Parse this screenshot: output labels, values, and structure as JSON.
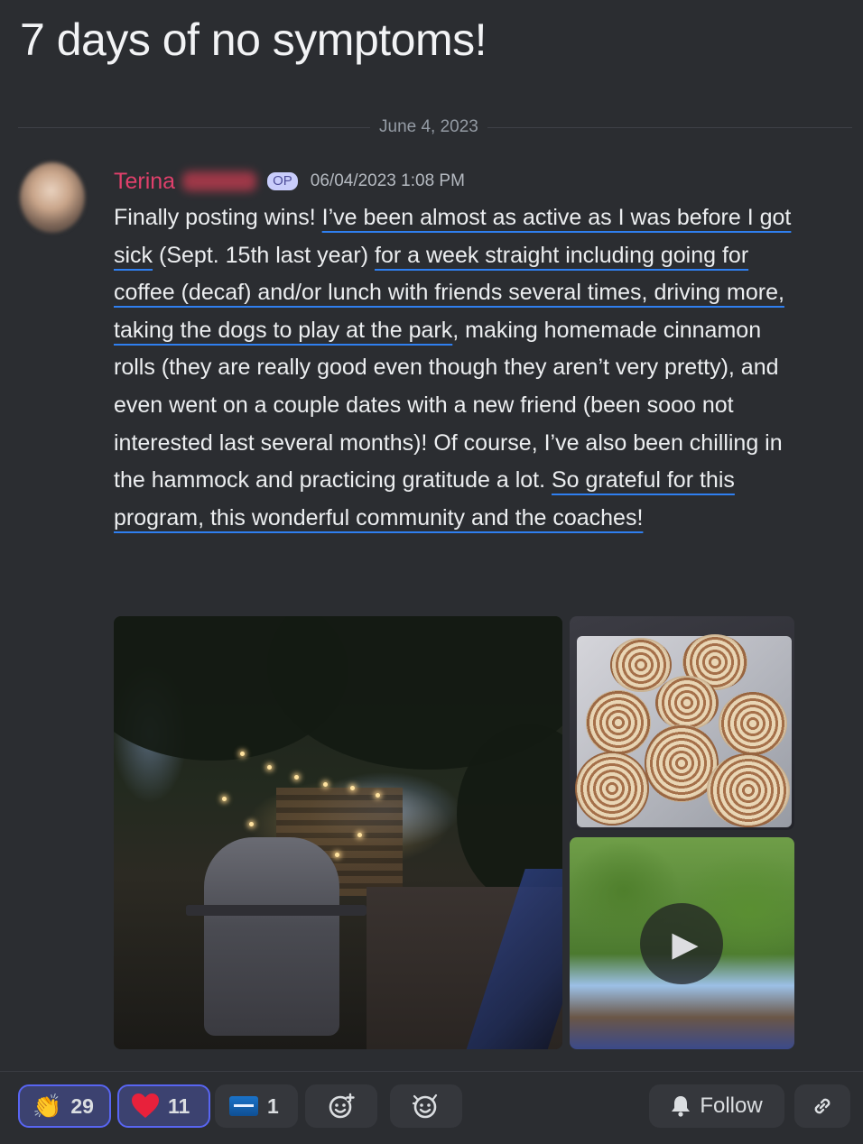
{
  "post": {
    "title": "7 days of no symptoms!",
    "date_divider": "June 4, 2023"
  },
  "message": {
    "author": "Terina",
    "badge": "OP",
    "timestamp": "06/04/2023 1:08 PM",
    "segments": [
      {
        "text": "Finally posting wins! ",
        "highlight": false
      },
      {
        "text": "I’ve been almost as active as I was before I got sick",
        "highlight": true
      },
      {
        "text": " (Sept. 15th last year) ",
        "highlight": false
      },
      {
        "text": "for a week straight including going for coffee (decaf) and/or lunch with friends several times, driving more,  taking the dogs to play at the park",
        "highlight": true
      },
      {
        "text": ", making homemade cinnamon rolls (they are really good even though they aren’t very pretty), and even went on a couple dates with a new friend (been sooo not interested last several months)! Of course, I’ve also been chilling in the hammock and practicing gratitude a lot. ",
        "highlight": false
      },
      {
        "text": "So grateful for this program, this wonderful community and the coaches!",
        "highlight": true
      }
    ]
  },
  "attachments": {
    "images": [
      "backyard-photo",
      "cinnamon-rolls-photo"
    ],
    "video": "tree-video"
  },
  "reactions": [
    {
      "icon": "clapping-hands-icon",
      "count": "29",
      "active": true
    },
    {
      "icon": "red-heart-icon",
      "count": "11",
      "active": true
    },
    {
      "icon": "card-icon",
      "count": "1",
      "active": false
    }
  ],
  "actions": {
    "follow_label": "Follow"
  },
  "colors": {
    "background": "#2b2d31",
    "author": "#e0406b",
    "highlight_underline": "#2f7ff0",
    "active_reaction_border": "#5865f2"
  }
}
